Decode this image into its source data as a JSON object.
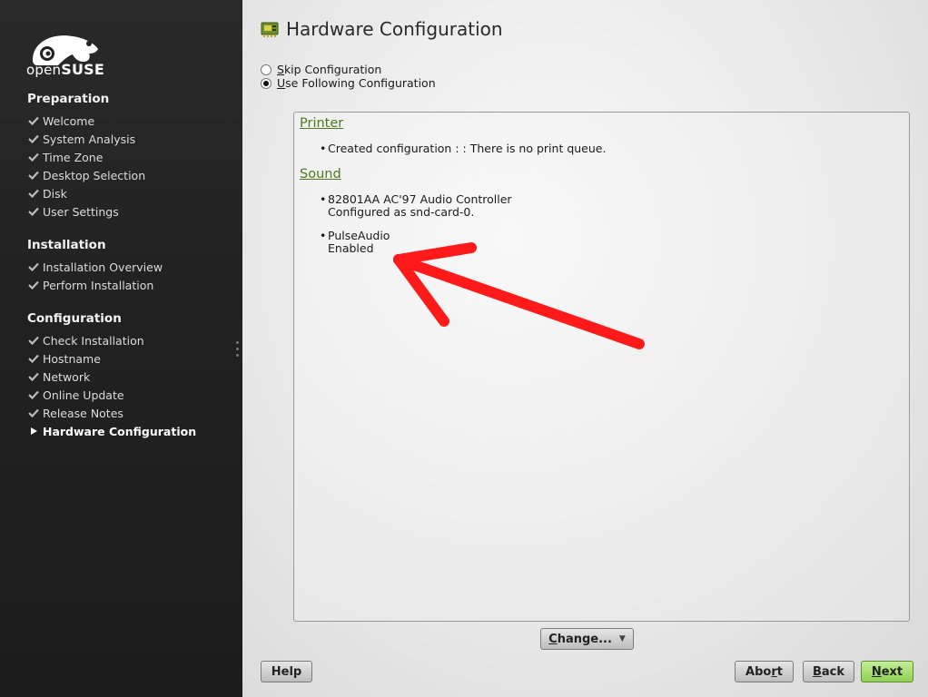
{
  "sidebar": {
    "logo": {
      "prefix": "open",
      "brand": "SUSE"
    },
    "sections": [
      {
        "title": "Preparation",
        "steps": [
          "Welcome",
          "System Analysis",
          "Time Zone",
          "Desktop Selection",
          "Disk",
          "User Settings"
        ]
      },
      {
        "title": "Installation",
        "steps": [
          "Installation Overview",
          "Perform Installation"
        ]
      },
      {
        "title": "Configuration",
        "steps": [
          "Check Installation",
          "Hostname",
          "Network",
          "Online Update",
          "Release Notes",
          "Hardware Configuration"
        ]
      }
    ],
    "current_step": "Hardware Configuration"
  },
  "main": {
    "title": "Hardware Configuration",
    "options": {
      "skip": {
        "accel": "S",
        "rest": "kip Configuration",
        "selected": false
      },
      "use": {
        "accel": "U",
        "rest": "se Following Configuration",
        "selected": true
      }
    },
    "summary": {
      "printer": {
        "heading": "Printer",
        "item": "Created configuration : : There is no print queue."
      },
      "sound": {
        "heading": "Sound",
        "item1_line1": "82801AA AC'97 Audio Controller",
        "item1_line2": "Configured as snd-card-0.",
        "item2_line1": "PulseAudio",
        "item2_line2": "Enabled"
      }
    },
    "change_button": {
      "accel": "C",
      "rest": "hange..."
    }
  },
  "footer": {
    "help": "Help",
    "abort": {
      "pre": "Abo",
      "accel": "r",
      "post": "t"
    },
    "back": {
      "accel": "B",
      "rest": "ack"
    },
    "next": {
      "accel": "N",
      "rest": "ext"
    }
  },
  "colors": {
    "sidebar_bg": "#222222",
    "category_link": "#4d7a1f",
    "next_button": "#9fd863",
    "annotation_arrow": "#ff1a1a"
  },
  "icons": [
    "opensuse-chameleon-logo",
    "checkmark-icon",
    "current-step-arrow-icon",
    "hardware-card-icon",
    "dropdown-caret-icon",
    "annotation-arrow"
  ]
}
